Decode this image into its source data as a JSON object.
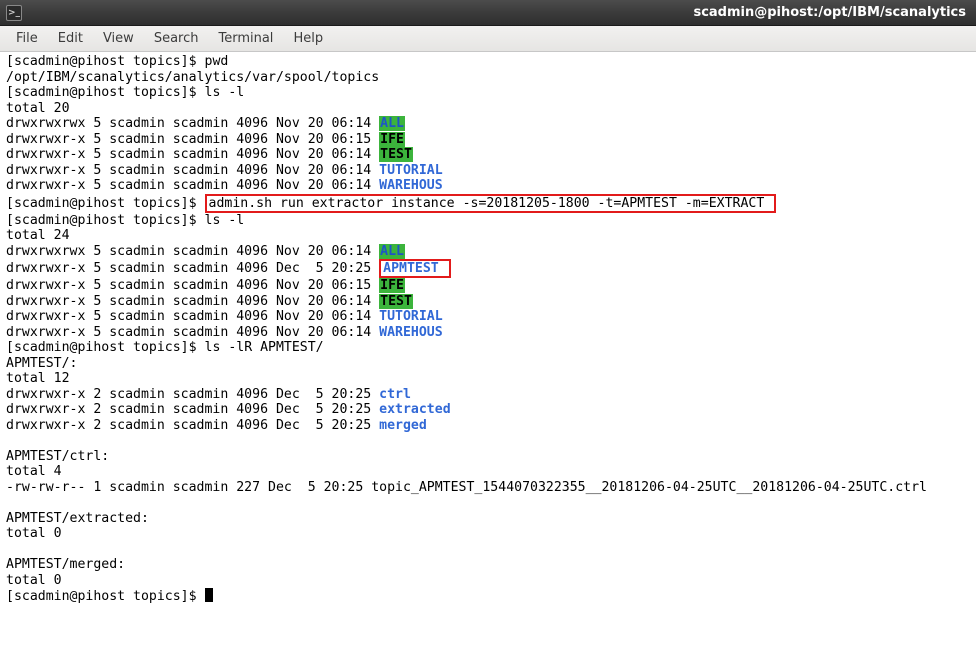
{
  "window": {
    "title": "scadmin@pihost:/opt/IBM/scanalytics"
  },
  "menu": {
    "file": "File",
    "edit": "Edit",
    "view": "View",
    "search": "Search",
    "terminal": "Terminal",
    "help": "Help"
  },
  "t": {
    "p1": "[scadmin@pihost topics]$ ",
    "cmd_pwd": "pwd",
    "pwd_out": "/opt/IBM/scanalytics/analytics/var/spool/topics",
    "cmd_ls1": "ls -l",
    "tot20": "total 20",
    "row_all": "drwxrwxrwx 5 scadmin scadmin 4096 Nov 20 06:14 ",
    "name_all": "ALL",
    "row_ife": "drwxrwxr-x 5 scadmin scadmin 4096 Nov 20 06:15 ",
    "name_ife": "IFE",
    "row_test": "drwxrwxr-x 5 scadmin scadmin 4096 Nov 20 06:14 ",
    "name_test": "TEST",
    "row_tut": "drwxrwxr-x 5 scadmin scadmin 4096 Nov 20 06:14 ",
    "name_tut": "TUTORIAL",
    "row_war": "drwxrwxr-x 5 scadmin scadmin 4096 Nov 20 06:14 ",
    "name_war": "WAREHOUS",
    "cmd_admin": "admin.sh run extractor instance -s=20181205-1800 -t=APMTEST -m=EXTRACT ",
    "cmd_ls2": "ls -l",
    "tot24": "total 24",
    "row2_all": "drwxrwxrwx 5 scadmin scadmin 4096 Nov 20 06:14 ",
    "row2_apm": "drwxrwxr-x 5 scadmin scadmin 4096 Dec  5 20:25 ",
    "name_apm": "APMTEST",
    "row2_ife": "drwxrwxr-x 5 scadmin scadmin 4096 Nov 20 06:15 ",
    "row2_test": "drwxrwxr-x 5 scadmin scadmin 4096 Nov 20 06:14 ",
    "row2_tut": "drwxrwxr-x 5 scadmin scadmin 4096 Nov 20 06:14 ",
    "row2_war": "drwxrwxr-x 5 scadmin scadmin 4096 Nov 20 06:14 ",
    "cmd_lslR": "ls -lR APMTEST/",
    "hdr_apm": "APMTEST/:",
    "tot12": "total 12",
    "sub_row": "drwxrwxr-x 2 scadmin scadmin 4096 Dec  5 20:25 ",
    "name_ctrl": "ctrl",
    "name_extr": "extracted",
    "name_merg": "merged",
    "hdr_ctrl": "APMTEST/ctrl:",
    "tot4": "total 4",
    "ctrl_row": "-rw-rw-r-- 1 scadmin scadmin 227 Dec  5 20:25 topic_APMTEST_1544070322355__20181206-04-25UTC__20181206-04-25UTC.ctrl",
    "hdr_extr": "APMTEST/extracted:",
    "tot0a": "total 0",
    "hdr_merg": "APMTEST/merged:",
    "tot0b": "total 0"
  }
}
